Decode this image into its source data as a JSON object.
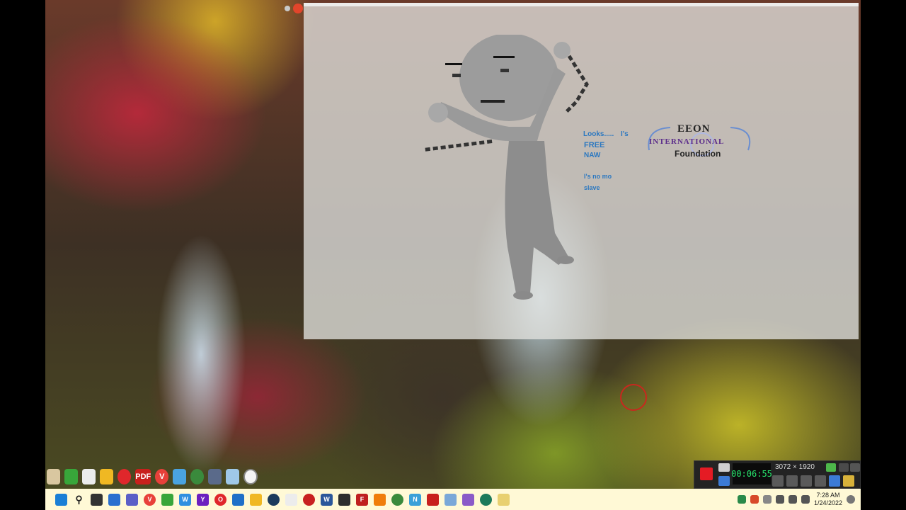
{
  "logo": {
    "top": "EEON",
    "mid": "INTERNATIONAL",
    "bottom": "Foundation"
  },
  "speech": {
    "line1": "Looks.....",
    "line1b": "I's",
    "line2": "FREE",
    "line3": "NAW",
    "line4": "I's no mo",
    "line5": "slave"
  },
  "recorder": {
    "timer": "00:06:55",
    "resolution": "3072 × 1920"
  },
  "clock": {
    "time": "7:28 AM",
    "date": "1/24/2022"
  },
  "colors": {
    "taskbar": "#fff9d6",
    "recorder_accent": "#27e36c",
    "record": "#e51b24"
  },
  "dock_icons": [
    "archive-icon",
    "evernote-icon",
    "hand-icon",
    "folder-icon",
    "opera-icon",
    "pdf-icon",
    "vivaldi-icon",
    "windows-icon",
    "chrome-icon",
    "monitor-icon",
    "recycle-bin-icon",
    "clock-icon"
  ],
  "taskbar_icons": [
    "windows-start-icon",
    "search-icon",
    "task-view-icon",
    "widgets-icon",
    "teams-icon",
    "vivaldi-icon",
    "evernote-icon",
    "wordpad-icon",
    "yahoo-icon",
    "opera-icon",
    "store-icon",
    "explorer-icon",
    "cortana-icon",
    "hand-icon",
    "record-icon",
    "word-icon",
    "terminal-icon",
    "filezilla-icon",
    "vlc-icon",
    "chrome-icon",
    "notepad-icon",
    "pdf-icon",
    "photos-icon",
    "paint-icon",
    "settings-icon",
    "folder-icon"
  ]
}
